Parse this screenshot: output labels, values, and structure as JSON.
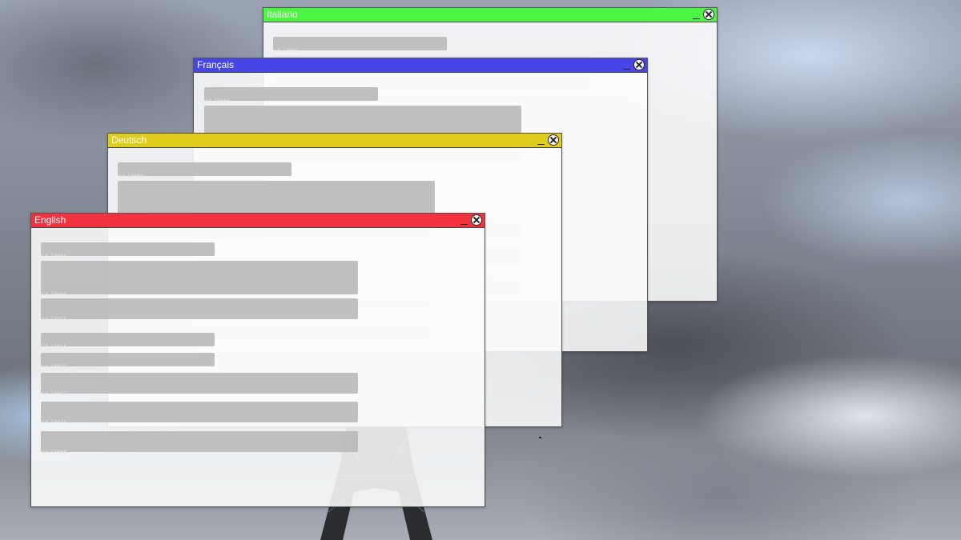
{
  "windows": {
    "italiano": {
      "title": "Italiano",
      "color": "#4cf544",
      "fields": [
        {
          "id": "id_10004"
        }
      ]
    },
    "francais": {
      "title": "Français",
      "color": "#4646e6",
      "fields": [
        {
          "id": "id_10004"
        }
      ]
    },
    "deutsch": {
      "title": "Deutsch",
      "color": "#e0cc1a",
      "fields": [
        {
          "id": "id_10004"
        },
        {
          "id": "id_10008"
        }
      ]
    },
    "english": {
      "title": "English",
      "color": "#f2333f",
      "fields": [
        {
          "id": "id_10004"
        },
        {
          "id": "id_10008"
        },
        {
          "id": "id_10015"
        },
        {
          "id": "id_10016"
        },
        {
          "id": "id_10023"
        },
        {
          "id": "id_10042"
        },
        {
          "id": "id_10073"
        },
        {
          "id": "id_10088"
        }
      ]
    }
  },
  "icons": {
    "minimize": "minimize-icon",
    "close": "close-icon"
  }
}
